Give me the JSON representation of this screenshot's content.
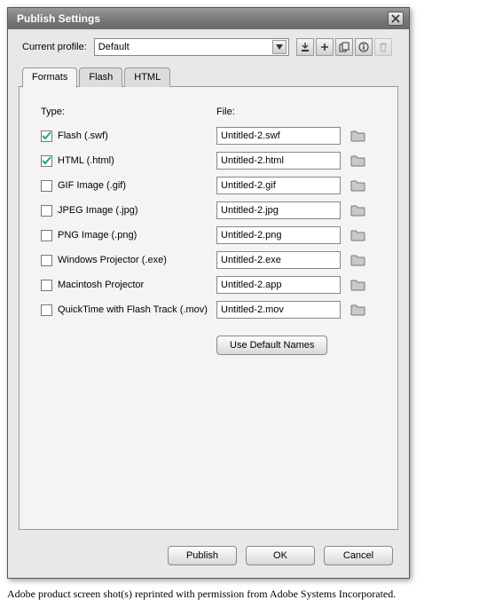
{
  "dialog": {
    "title": "Publish Settings",
    "profile_label": "Current profile:",
    "profile_value": "Default",
    "tabs": [
      {
        "label": "Formats",
        "active": true
      },
      {
        "label": "Flash",
        "active": false
      },
      {
        "label": "HTML",
        "active": false
      }
    ],
    "col_type": "Type:",
    "col_file": "File:",
    "formats": [
      {
        "checked": true,
        "type_label": "Flash (.swf)",
        "file": "Untitled-2.swf"
      },
      {
        "checked": true,
        "type_label": "HTML (.html)",
        "file": "Untitled-2.html"
      },
      {
        "checked": false,
        "type_label": "GIF Image (.gif)",
        "file": "Untitled-2.gif"
      },
      {
        "checked": false,
        "type_label": "JPEG Image (.jpg)",
        "file": "Untitled-2.jpg"
      },
      {
        "checked": false,
        "type_label": "PNG Image (.png)",
        "file": "Untitled-2.png"
      },
      {
        "checked": false,
        "type_label": "Windows Projector (.exe)",
        "file": "Untitled-2.exe"
      },
      {
        "checked": false,
        "type_label": "Macintosh Projector",
        "file": "Untitled-2.app"
      },
      {
        "checked": false,
        "type_label": "QuickTime with Flash Track (.mov)",
        "file": "Untitled-2.mov"
      }
    ],
    "use_default_label": "Use Default Names",
    "publish_label": "Publish",
    "ok_label": "OK",
    "cancel_label": "Cancel"
  },
  "caption": "Adobe product screen shot(s) reprinted with permission from Adobe Systems Incorporated."
}
